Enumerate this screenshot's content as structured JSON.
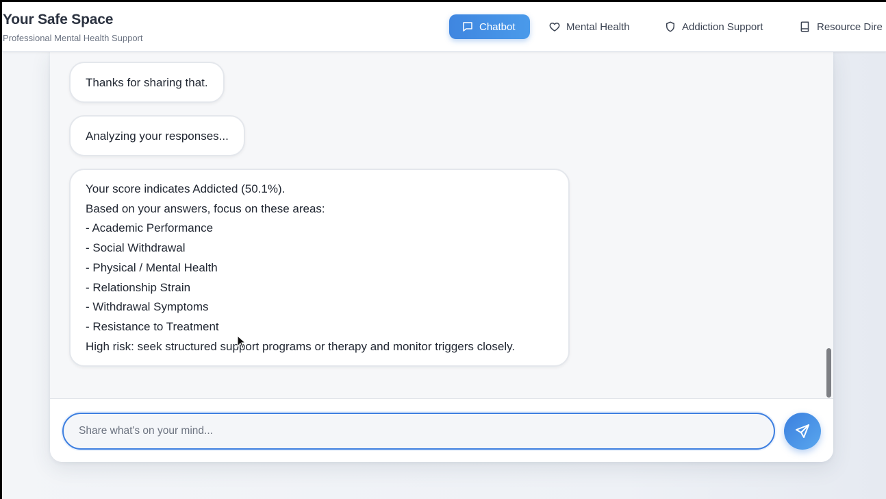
{
  "header": {
    "title": "Your Safe Space",
    "subtitle": "Professional Mental Health Support",
    "nav": [
      {
        "label": "Chatbot",
        "icon": "chat-bubble-icon",
        "active": true
      },
      {
        "label": "Mental Health",
        "icon": "heart-icon",
        "active": false
      },
      {
        "label": "Addiction Support",
        "icon": "shield-icon",
        "active": false
      },
      {
        "label": "Resource Dire",
        "icon": "book-icon",
        "active": false
      }
    ]
  },
  "chat": {
    "messages": [
      {
        "lines": [
          "Thanks for sharing that."
        ]
      },
      {
        "lines": [
          "Analyzing your responses..."
        ]
      },
      {
        "lines": [
          "Your score indicates Addicted (50.1%).",
          "Based on your answers, focus on these areas:",
          "- Academic Performance",
          "- Social Withdrawal",
          "- Physical / Mental Health",
          "- Relationship Strain",
          "- Withdrawal Symptoms",
          "- Resistance to Treatment",
          "High risk: seek structured support programs or therapy and monitor triggers closely."
        ]
      }
    ],
    "input": {
      "value": "",
      "placeholder": "Share what's on your mind..."
    },
    "send_icon": "send-icon"
  },
  "colors": {
    "accent": "#3f86e0",
    "input_border": "#3d7fe0"
  }
}
